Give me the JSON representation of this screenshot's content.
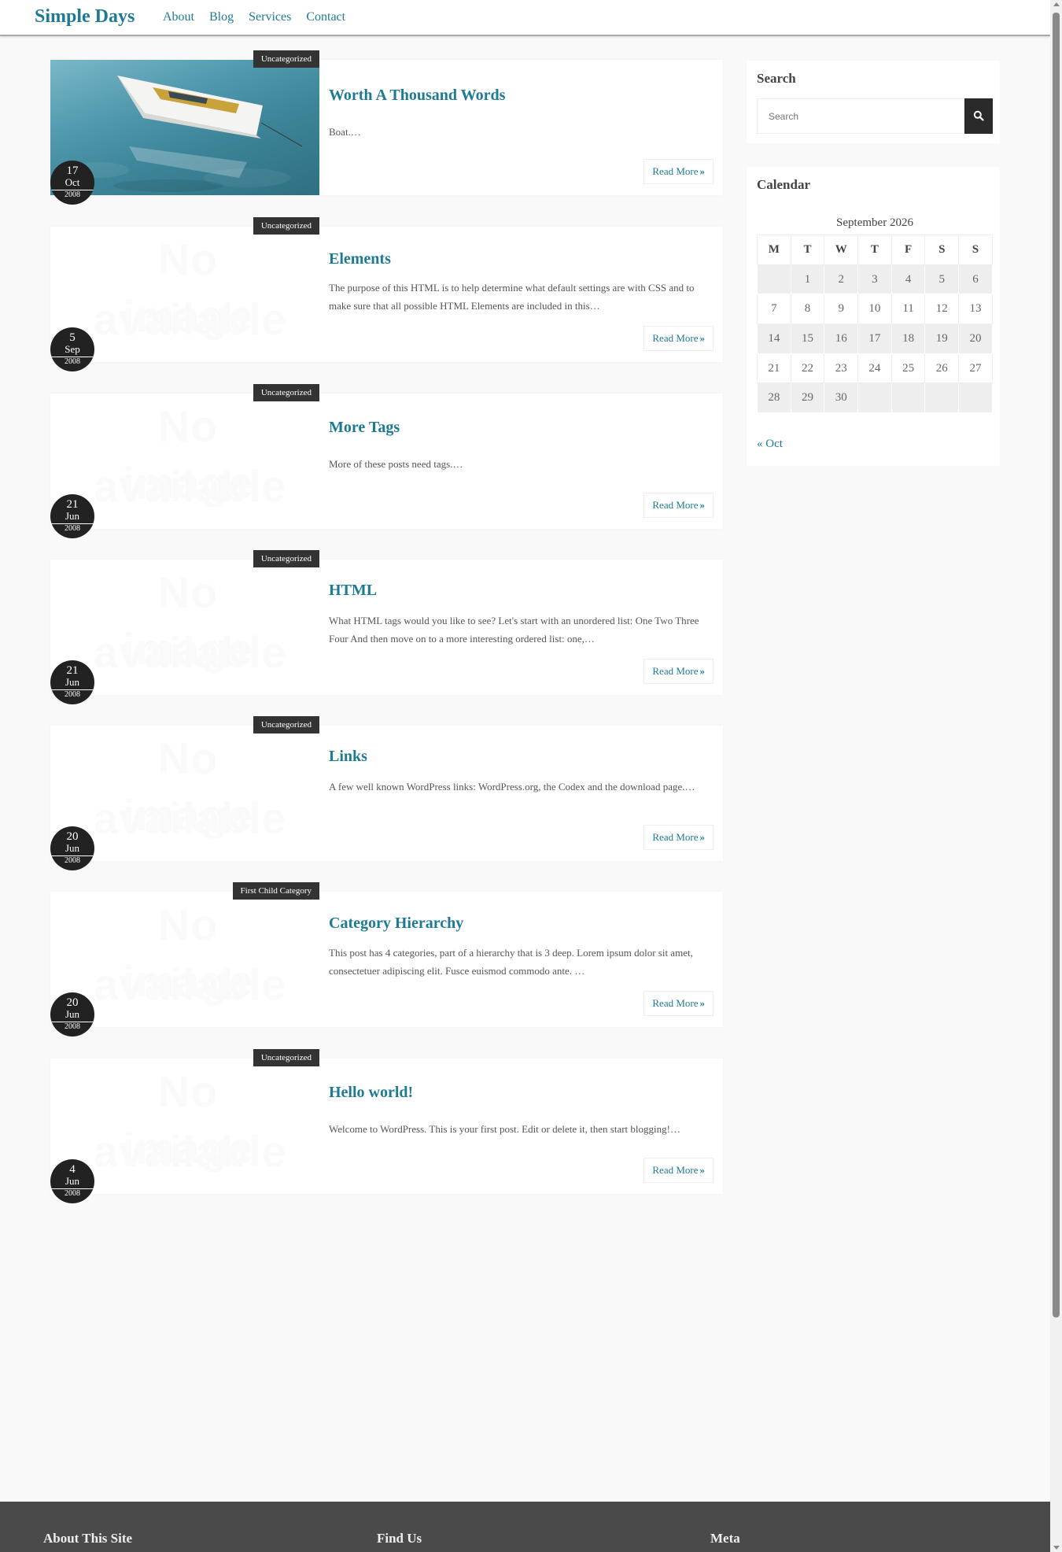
{
  "header": {
    "site_title": "Simple Days",
    "nav": [
      "About",
      "Blog",
      "Services",
      "Contact"
    ]
  },
  "posts": [
    {
      "category": "Uncategorized",
      "title": "Worth A Thousand Words",
      "excerpt": "Boat.…",
      "day": "17",
      "month": "Oct",
      "year": "2008",
      "read_more": "Read More",
      "has_image": true
    },
    {
      "category": "Uncategorized",
      "title": "Elements",
      "excerpt": "The purpose of this HTML is to help determine what default settings are with CSS and to make sure that all possible HTML Elements are included in this…",
      "day": "5",
      "month": "Sep",
      "year": "2008",
      "read_more": "Read More",
      "has_image": false
    },
    {
      "category": "Uncategorized",
      "title": "More Tags",
      "excerpt": "More of these posts need tags.…",
      "day": "21",
      "month": "Jun",
      "year": "2008",
      "read_more": "Read More",
      "has_image": false
    },
    {
      "category": "Uncategorized",
      "title": "HTML",
      "excerpt": "What HTML tags would you like to see? Let's start with an unordered list: One Two Three Four And then move on to a more interesting ordered list: one,…",
      "day": "21",
      "month": "Jun",
      "year": "2008",
      "read_more": "Read More",
      "has_image": false
    },
    {
      "category": "Uncategorized",
      "title": "Links",
      "excerpt": "A few well known WordPress links: WordPress.org, the Codex and the download page.…",
      "day": "20",
      "month": "Jun",
      "year": "2008",
      "read_more": "Read More",
      "has_image": false
    },
    {
      "category": "First Child Category",
      "title": "Category Hierarchy",
      "excerpt": "This post has 4 categories, part of a hierarchy that is 3 deep. Lorem ipsum dolor sit amet, consectetuer adipiscing elit. Fusce euismod commodo ante. …",
      "day": "20",
      "month": "Jun",
      "year": "2008",
      "read_more": "Read More",
      "has_image": false
    },
    {
      "category": "Uncategorized",
      "title": "Hello world!",
      "excerpt": "Welcome to WordPress. This is your first post. Edit or delete it, then start blogging!…",
      "day": "4",
      "month": "Jun",
      "year": "2008",
      "read_more": "Read More",
      "has_image": false
    }
  ],
  "no_image": {
    "line1": "No image",
    "line2": "available"
  },
  "sidebar": {
    "search": {
      "title": "Search",
      "placeholder": "Search"
    },
    "calendar": {
      "title": "Calendar",
      "caption": "September 2026",
      "weekdays": [
        "M",
        "T",
        "W",
        "T",
        "F",
        "S",
        "S"
      ],
      "weeks": [
        [
          "",
          "1",
          "2",
          "3",
          "4",
          "5",
          "6"
        ],
        [
          "7",
          "8",
          "9",
          "10",
          "11",
          "12",
          "13"
        ],
        [
          "14",
          "15",
          "16",
          "17",
          "18",
          "19",
          "20"
        ],
        [
          "21",
          "22",
          "23",
          "24",
          "25",
          "26",
          "27"
        ],
        [
          "28",
          "29",
          "30",
          "",
          "",
          "",
          ""
        ]
      ],
      "prev_link": "« Oct"
    }
  },
  "footer": {
    "columns": [
      "About This Site",
      "Find Us",
      "Meta"
    ]
  },
  "colors": {
    "accent": "#1e7a94",
    "dark": "#333333",
    "footer": "#4a4a4a"
  }
}
